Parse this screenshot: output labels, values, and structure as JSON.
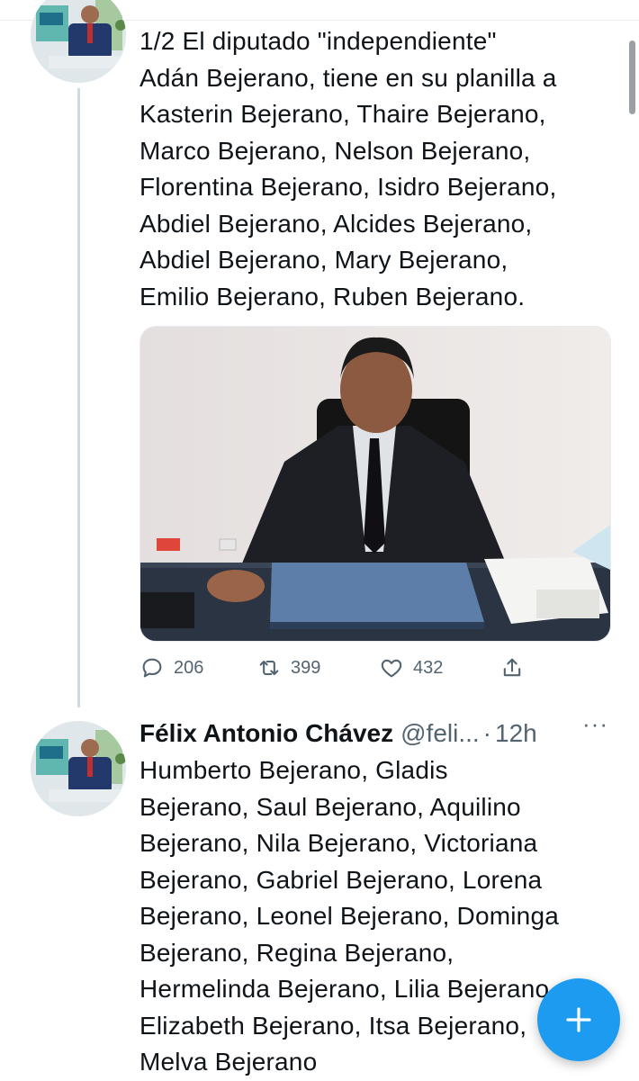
{
  "tweet1": {
    "text": "1/2 El diputado \"independiente\"\nAdán Bejerano, tiene en su planilla a\nKasterin Bejerano, Thaire Bejerano,\nMarco Bejerano, Nelson Bejerano,\nFlorentina Bejerano, Isidro Bejerano,\nAbdiel Bejerano, Alcides Bejerano,\nAbdiel Bejerano, Mary Bejerano,\nEmilio Bejerano, Ruben Bejerano.",
    "replies": "206",
    "retweets": "399",
    "likes": "432"
  },
  "tweet2": {
    "author_name": "Félix Antonio Chávez",
    "handle": "@feli...",
    "separator": "·",
    "time": "12h",
    "more": "···",
    "text": "Humberto Bejerano, Gladis\nBejerano, Saul Bejerano, Aquilino\nBejerano, Nila Bejerano, Victoriana\nBejerano, Gabriel Bejerano, Lorena\nBejerano, Leonel Bejerano, Dominga\nBejerano, Regina Bejerano,\nHermelinda Bejerano, Lilia Bejerano,\nElizabeth Bejerano, Itsa Bejerano,\nMelva Bejerano"
  },
  "colors": {
    "accent": "#1d9bf0",
    "text": "#0f1419",
    "secondary": "#536471",
    "thread_line": "#cfd9de"
  },
  "icons": [
    "reply-icon",
    "retweet-icon",
    "like-icon",
    "share-icon",
    "more-icon",
    "compose-plus-icon"
  ]
}
